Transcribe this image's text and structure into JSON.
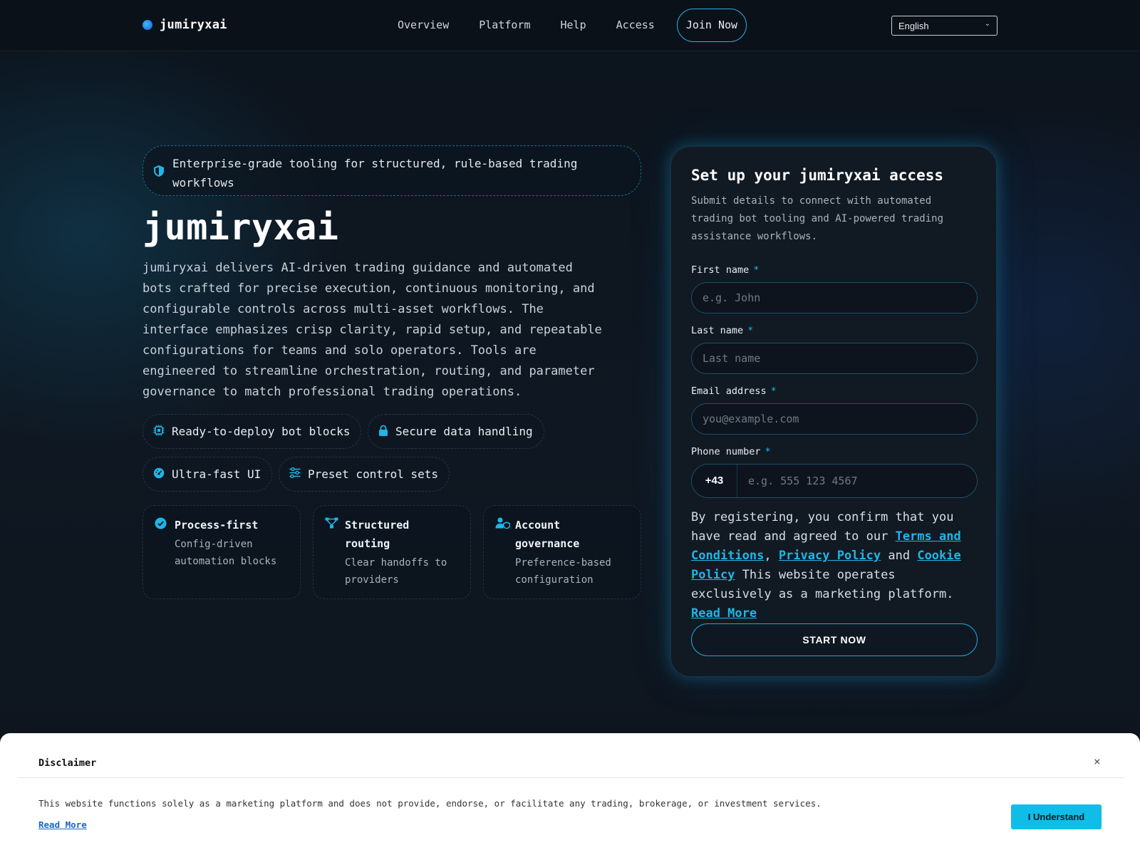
{
  "nav": {
    "brand": "jumiryxai",
    "links": [
      "Overview",
      "Platform",
      "Help",
      "Access"
    ],
    "join": "Join Now",
    "language": "English"
  },
  "hero": {
    "tagline": "Enterprise-grade tooling for structured, rule-based trading workflows",
    "title": "jumiryxai",
    "description": "jumiryxai delivers AI-driven trading guidance and automated bots crafted for precise execution, continuous monitoring, and configurable controls across multi-asset workflows. The interface emphasizes crisp clarity, rapid setup, and repeatable configurations for teams and solo operators. Tools are engineered to streamline orchestration, routing, and parameter governance to match professional trading operations.",
    "chips": [
      {
        "label": "Ready-to-deploy bot blocks",
        "icon": "chip-icon"
      },
      {
        "label": "Secure data handling",
        "icon": "lock-icon"
      },
      {
        "label": "Ultra-fast UI",
        "icon": "speed-gauge-icon"
      },
      {
        "label": "Preset control sets",
        "icon": "sliders-icon"
      }
    ],
    "features": [
      {
        "title": "Process-first",
        "sub": "Config-driven automation blocks",
        "icon": "check-circle-icon"
      },
      {
        "title": "Structured routing",
        "sub": "Clear handoffs to providers",
        "icon": "routing-icon"
      },
      {
        "title": "Account governance",
        "sub": "Preference-based configuration",
        "icon": "user-shield-icon"
      }
    ]
  },
  "form": {
    "title": "Set up your jumiryxai access",
    "subtitle": "Submit details to connect with automated trading bot tooling and AI-powered trading assistance workflows.",
    "required_mark": "*",
    "first_name_label": "First name",
    "first_name_placeholder": "e.g. John",
    "last_name_label": "Last name",
    "last_name_placeholder": "Last name",
    "email_label": "Email address",
    "email_placeholder": "you@example.com",
    "phone_label": "Phone number",
    "phone_code": "+43",
    "phone_placeholder": "e.g. 555 123 4567",
    "consent_prefix": "By registering, you confirm that you have read and agreed to our ",
    "terms_link": "Terms and Conditions",
    "comma": ", ",
    "privacy_link": "Privacy Policy",
    "and": " and ",
    "cookie_link": "Cookie Policy",
    "consent_suffix": " This website operates exclusively as a marketing platform. ",
    "read_more_link": "Read More",
    "submit": "START NOW"
  },
  "disclaimer": {
    "title": "Disclaimer",
    "close": "×",
    "text": "This website functions solely as a marketing platform and does not provide, endorse, or facilitate any trading, brokerage, or investment services.",
    "read_more": "Read More",
    "button": "I Understand"
  },
  "colors": {
    "accent": "#1fb6e6",
    "background": "#0b111a",
    "card": "#111923"
  }
}
